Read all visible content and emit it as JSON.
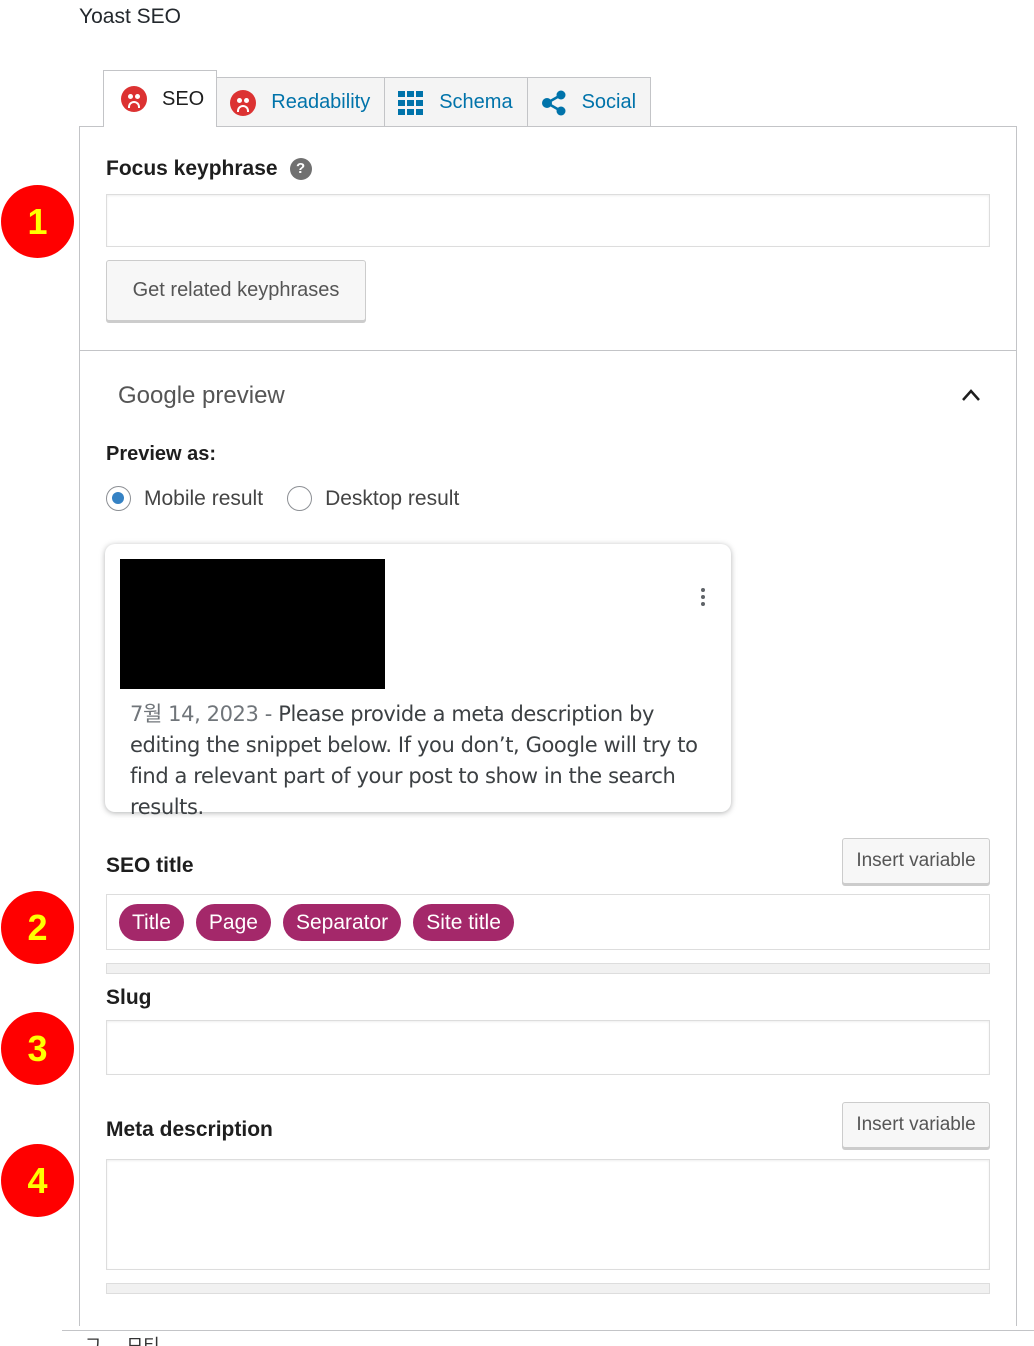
{
  "panel": {
    "title": "Yoast SEO"
  },
  "tabs": [
    {
      "label": "SEO",
      "icon": "sad-face-icon"
    },
    {
      "label": "Readability",
      "icon": "sad-face-icon"
    },
    {
      "label": "Schema",
      "icon": "grid-icon"
    },
    {
      "label": "Social",
      "icon": "share-icon"
    }
  ],
  "focus_keyphrase": {
    "label": "Focus keyphrase",
    "help": "?",
    "value": "",
    "button": "Get related keyphrases"
  },
  "google_preview": {
    "heading": "Google preview",
    "preview_as_label": "Preview as:",
    "options": [
      "Mobile result",
      "Desktop result"
    ],
    "selected": "Mobile result",
    "snippet_date": "7월 14, 2023",
    "snippet_sep": " - ",
    "snippet_text": "Please provide a meta description by editing the snippet below. If you don’t, Google will try to find a relevant part of your post to show in the search results."
  },
  "seo_title": {
    "label": "SEO title",
    "insert_button": "Insert variable",
    "variables": [
      "Title",
      "Page",
      "Separator",
      "Site title"
    ]
  },
  "slug": {
    "label": "Slug",
    "value": ""
  },
  "meta_description": {
    "label": "Meta description",
    "insert_button": "Insert variable",
    "value": ""
  },
  "markers": [
    "1",
    "2",
    "3",
    "4"
  ],
  "colors": {
    "accent": "#a4286a",
    "error": "#dc3232",
    "link": "#0073aa",
    "marker": "#ff0000",
    "marker_text": "#ffff00"
  },
  "footer_partial_text": "그 ... 모티"
}
